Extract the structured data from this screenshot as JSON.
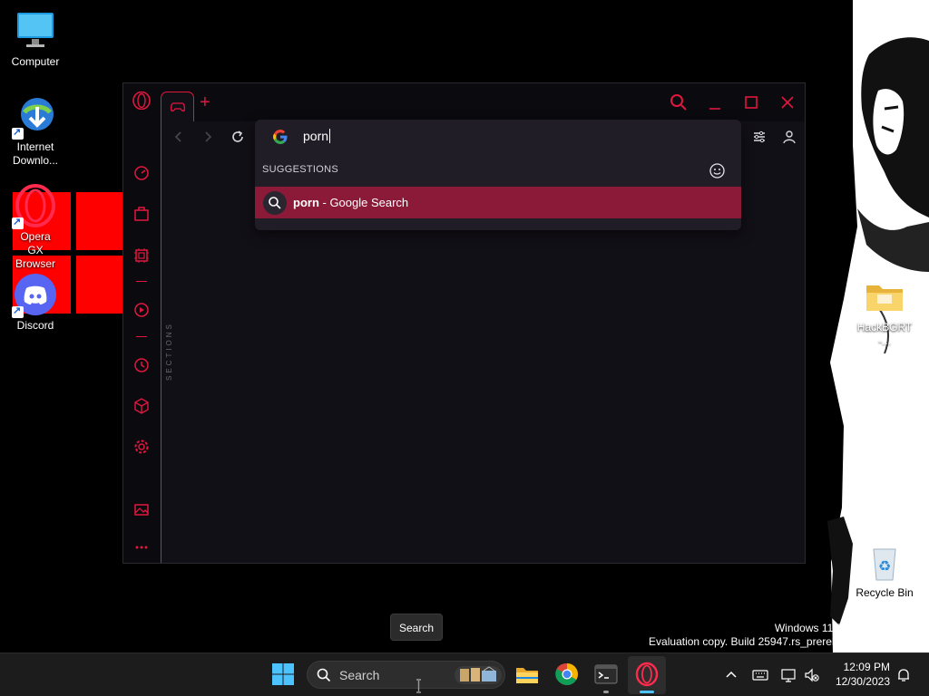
{
  "desktop": {
    "icons": [
      {
        "label": "Computer"
      },
      {
        "label": "Internet Downlo..."
      },
      {
        "label": "Opera GX Browser"
      },
      {
        "label": "Discord"
      },
      {
        "label": "HackBGRT -..."
      },
      {
        "label": "Recycle Bin"
      }
    ]
  },
  "browser": {
    "sidebar_sections_label": "SECTIONS",
    "omnibox": {
      "typed_text": "porn",
      "suggestions_heading": "SUGGESTIONS",
      "suggestions": [
        {
          "bold": "porn",
          "rest": " - Google Search"
        }
      ]
    }
  },
  "tooltip": {
    "text": "Search"
  },
  "watermark": {
    "line1": "Windows 11 Pro Insid",
    "line2": "Evaluation copy. Build 25947.rs_prerelease.230"
  },
  "taskbar": {
    "search_placeholder": "Search",
    "time": "12:09 PM",
    "date": "12/30/2023"
  },
  "colors": {
    "accent": "#e1173f",
    "suggestion_highlight": "#8b1a38",
    "windows_blue": "#4cc2ff"
  }
}
